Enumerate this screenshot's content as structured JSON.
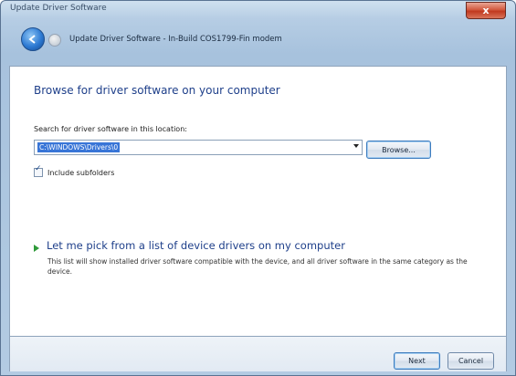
{
  "window": {
    "titlebar_text": "Update Driver Software",
    "close_glyph": "x",
    "wizard_title": "Update Driver Software - In-Build COS1799-Fin modem"
  },
  "page": {
    "heading": "Browse for driver software on your computer",
    "search_label": "Search for driver software in this location:",
    "path_value": "C:\\WINDOWS\\Drivers\\0",
    "browse_label": "Browse...",
    "include_subfolders_label": "Include subfolders",
    "include_subfolders_checked": true,
    "pick_link": "Let me pick from a list of device drivers on my computer",
    "pick_description": "This list will show installed driver software compatible with the device, and all driver software in the same category as the device."
  },
  "footer": {
    "next_label": "Next",
    "cancel_label": "Cancel"
  },
  "icons": {
    "back": "back-arrow-icon",
    "forward": "forward-arrow-icon",
    "close": "close-icon",
    "pick_arrow": "green-arrow-icon",
    "dropdown": "chevron-down-icon",
    "check": "checkmark-icon"
  },
  "colors": {
    "heading": "#1e3f8a",
    "selection": "#3875d7",
    "close_button": "#c0391f",
    "pick_arrow": "#2f9a3a"
  }
}
